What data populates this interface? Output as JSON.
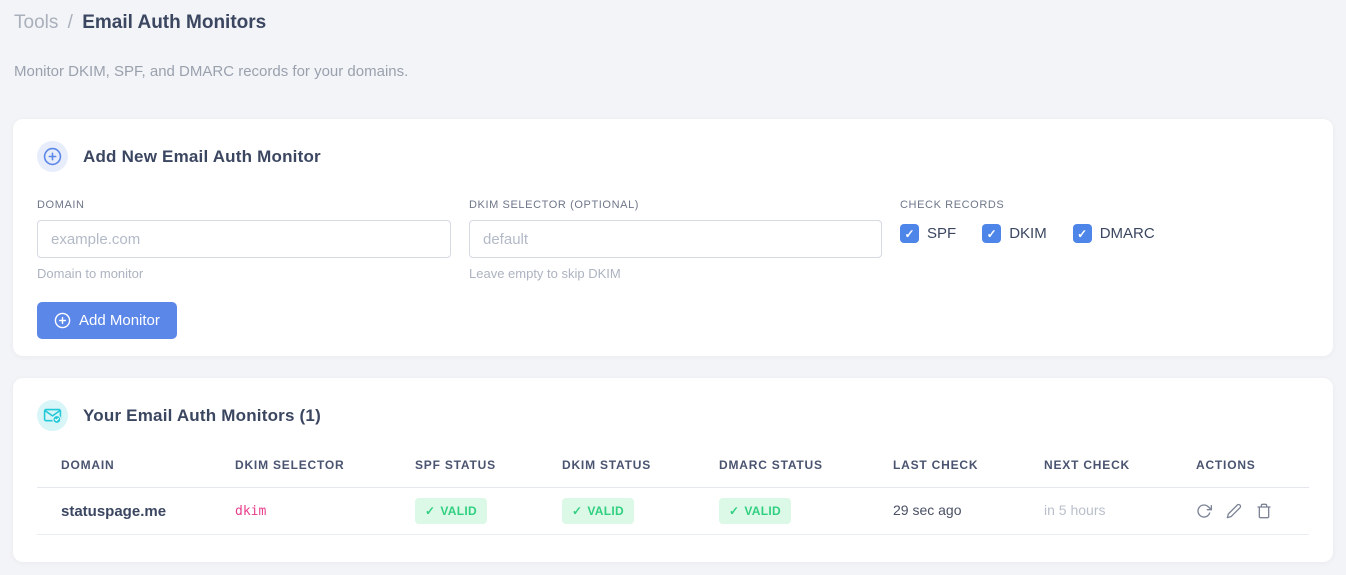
{
  "page": {
    "breadcrumb": {
      "section": "Tools",
      "separator": "/",
      "current": "Email Auth Monitors"
    },
    "subtitle": "Monitor DKIM, SPF, and DMARC records for your domains."
  },
  "icons": {
    "check": "✓"
  },
  "colors": {
    "accent_blue": "#5b87e8",
    "checkbox_blue": "#4d85e9",
    "accent_cyan": "#22c9d6",
    "valid_green": "#2fd080",
    "valid_green_bg": "#dcf8e7",
    "code_pink": "#e83e8c"
  },
  "add_card": {
    "title": "Add New Email Auth Monitor",
    "domain_field": {
      "label": "DOMAIN",
      "placeholder": "example.com",
      "value": "",
      "helper": "Domain to monitor"
    },
    "dkim_field": {
      "label": "DKIM SELECTOR (OPTIONAL)",
      "placeholder": "default",
      "value": "",
      "helper": "Leave empty to skip DKIM"
    },
    "check_records": {
      "label": "CHECK RECORDS",
      "options": [
        {
          "label": "SPF",
          "checked": true
        },
        {
          "label": "DKIM",
          "checked": true
        },
        {
          "label": "DMARC",
          "checked": true
        }
      ]
    },
    "submit_label": "Add Monitor"
  },
  "monitors_card": {
    "title": "Your Email Auth Monitors (1)",
    "table": {
      "headers": [
        "DOMAIN",
        "DKIM SELECTOR",
        "SPF STATUS",
        "DKIM STATUS",
        "DMARC STATUS",
        "LAST CHECK",
        "NEXT CHECK",
        "ACTIONS"
      ],
      "rows": [
        {
          "domain": "statuspage.me",
          "dkim_selector": "dkim",
          "spf_status": "VALID",
          "dkim_status": "VALID",
          "dmarc_status": "VALID",
          "last_check": "29 sec ago",
          "next_check": "in 5 hours"
        }
      ]
    }
  }
}
